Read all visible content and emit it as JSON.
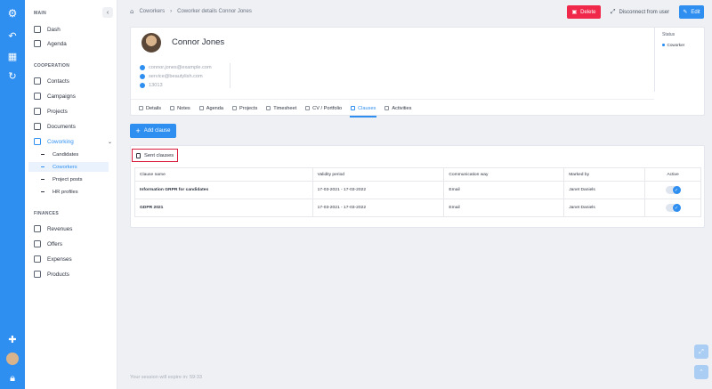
{
  "app": {
    "accent": "#2f8ff0",
    "danger": "#f0284a"
  },
  "sidebar": {
    "sections": {
      "main": "MAIN",
      "cooperation": "COOPERATION",
      "finances": "FINANCES"
    },
    "main_items": [
      {
        "label": "Dash",
        "icon": "home-icon"
      },
      {
        "label": "Agenda",
        "icon": "calendar-icon"
      }
    ],
    "cooperation_items": [
      {
        "label": "Contacts",
        "icon": "contacts-icon"
      },
      {
        "label": "Campaigns",
        "icon": "megaphone-icon"
      },
      {
        "label": "Projects",
        "icon": "clipboard-icon"
      },
      {
        "label": "Documents",
        "icon": "document-icon"
      },
      {
        "label": "Coworking",
        "icon": "layers-icon"
      }
    ],
    "coworking_sub": [
      "Candidates",
      "Coworkers",
      "Project posts",
      "HR profiles"
    ],
    "finance_items": [
      {
        "label": "Revenues",
        "icon": "revenue-icon"
      },
      {
        "label": "Offers",
        "icon": "offer-icon"
      },
      {
        "label": "Expenses",
        "icon": "cart-icon"
      },
      {
        "label": "Products",
        "icon": "box-icon"
      }
    ]
  },
  "breadcrumb": {
    "root": "Coworkers",
    "sep": "›",
    "current": "Coworker details Connor Jones"
  },
  "actions": {
    "delete": "Delete",
    "disconnect": "Disconnect from user",
    "edit": "Edit"
  },
  "profile": {
    "name": "Connor Jones",
    "email1": "connor.jones@example.com",
    "email2": "service@beautylish.com",
    "phone": "13013",
    "status_label": "Status",
    "status_value": "Coworker"
  },
  "tabs": [
    "Details",
    "Notes",
    "Agenda",
    "Projects",
    "Timesheet",
    "CV / Portfolio",
    "Clauses",
    "Activities"
  ],
  "add_clause": "Add clause",
  "sent_clauses": {
    "title": "Sent clauses",
    "headers": [
      "Clause name",
      "Validity period",
      "Communication way",
      "Marked by",
      "Active"
    ],
    "rows": [
      {
        "name": "Information GRPR for candidates",
        "period": "17-03-2021 - 17-03-2022",
        "way": "Email",
        "by": "Janet Daniels",
        "active": true
      },
      {
        "name": "GDPR 2021",
        "period": "17-03-2021 - 17-03-2022",
        "way": "Email",
        "by": "Janet Daniels",
        "active": true
      }
    ]
  },
  "session": "Your session will expire in: 59:33"
}
